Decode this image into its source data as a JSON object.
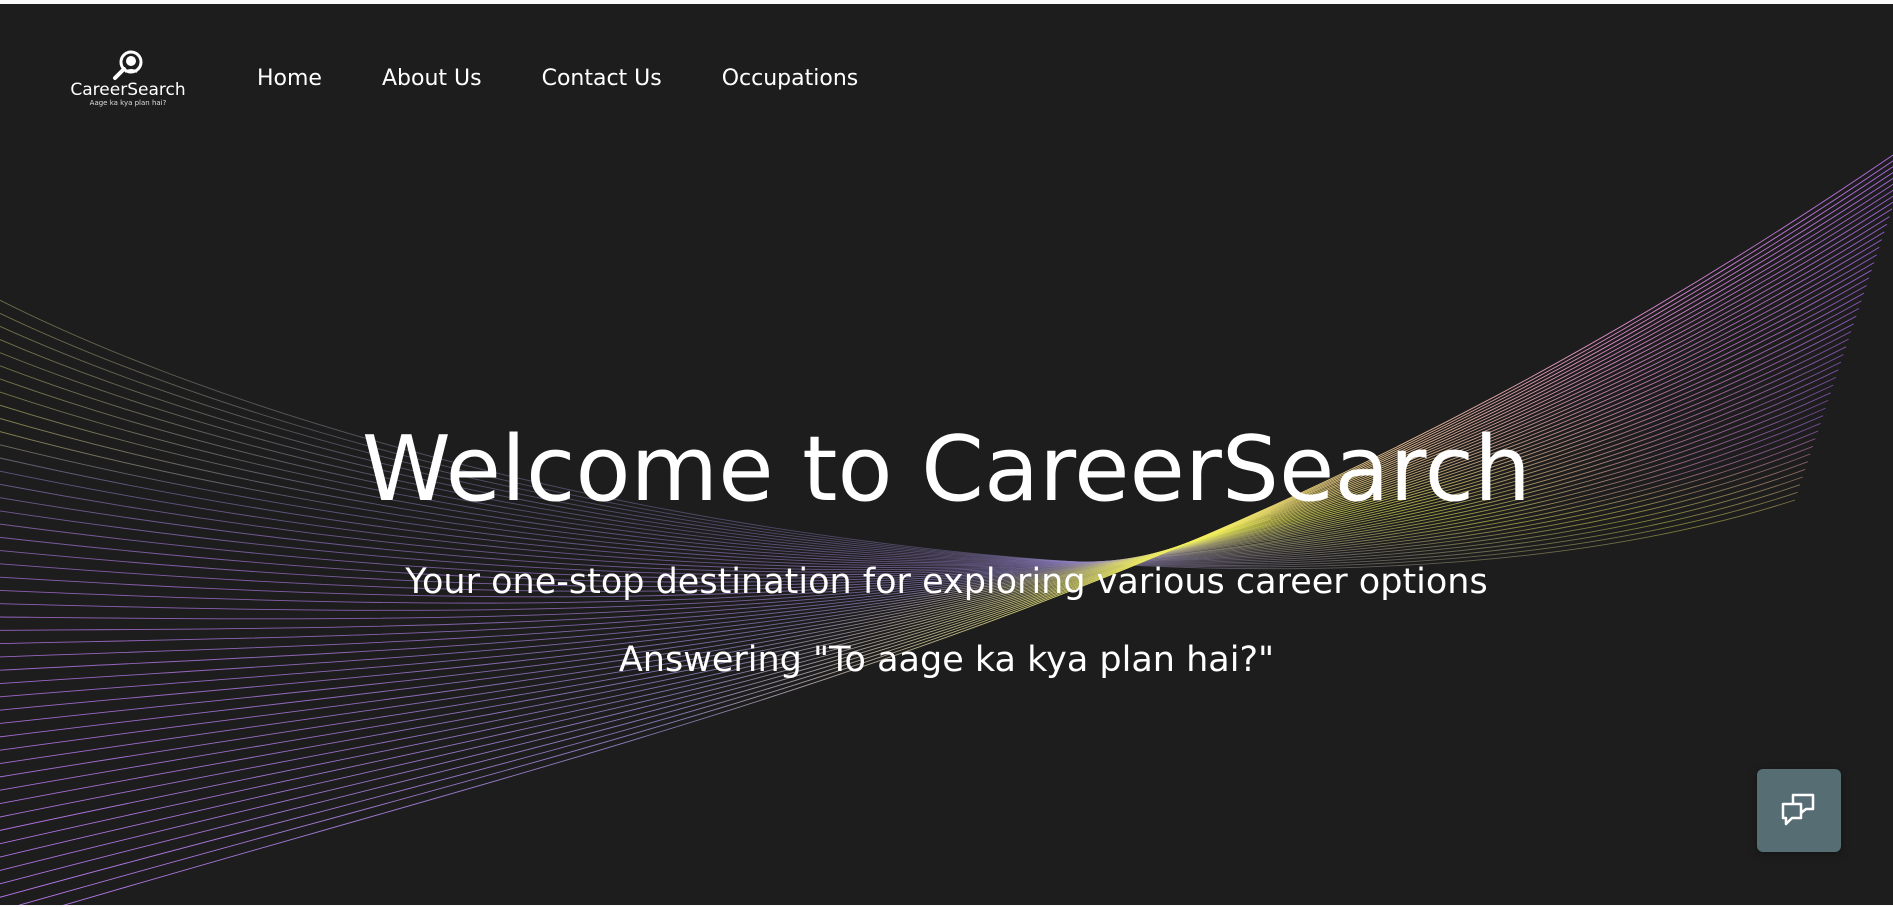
{
  "brand": {
    "name": "CareerSearch",
    "tagline": "Aage ka kya plan hai?"
  },
  "nav": {
    "items": [
      {
        "label": "Home"
      },
      {
        "label": "About Us"
      },
      {
        "label": "Contact Us"
      },
      {
        "label": "Occupations"
      }
    ]
  },
  "hero": {
    "title": "Welcome to CareerSearch",
    "subtitle": "Your one-stop destination for exploring various career options",
    "tagline": "Answering \"To aage ka kya plan hai?\""
  },
  "chat": {
    "icon": "chat-bubbles-icon"
  },
  "colors": {
    "background": "#1d1d1d",
    "wave_violet": "#c77dff",
    "wave_yellow": "#f2f25a",
    "chat_button": "#566d74"
  }
}
